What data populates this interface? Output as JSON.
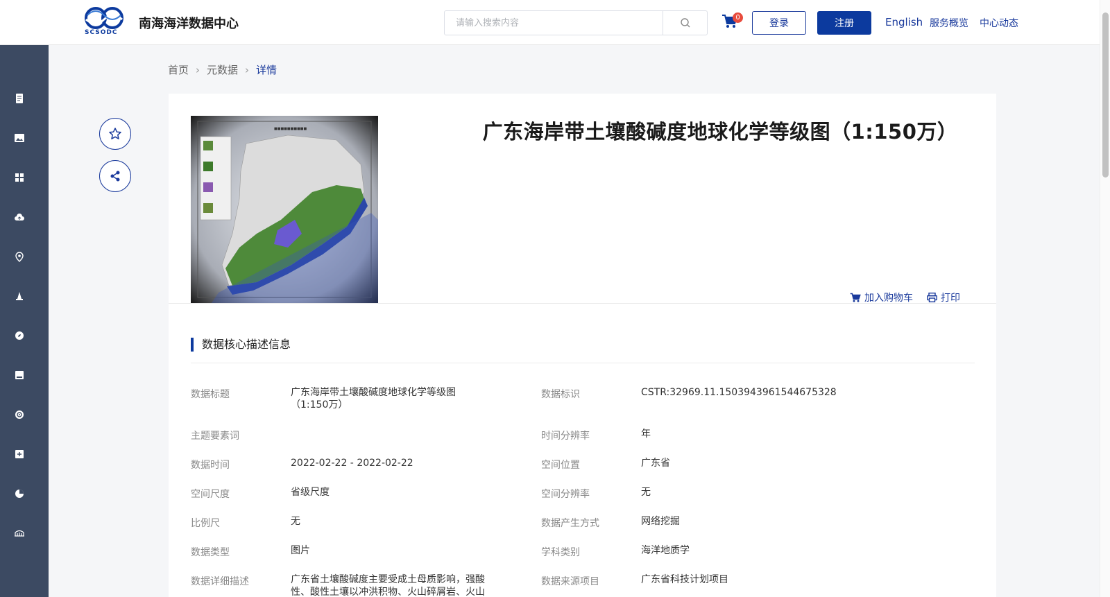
{
  "header": {
    "logo_text": "SCSODC",
    "site_name": "南海海洋数据中心",
    "search_placeholder": "请输入搜索内容",
    "cart_count": "0",
    "login_label": "登录",
    "register_label": "注册",
    "nav": [
      "English",
      "服务概览",
      "中心动态"
    ]
  },
  "sidebar": {
    "icons": [
      "document-icon",
      "image-icon",
      "grid-icon",
      "cloud-upload-icon",
      "location-icon",
      "tower-icon",
      "compass-icon",
      "card-icon",
      "target-icon",
      "plus-box-icon",
      "pie-chart-icon",
      "bridge-icon"
    ]
  },
  "breadcrumb": [
    "首页",
    "元数据",
    "详情"
  ],
  "detail": {
    "title": "广东海岸带土壤酸碱度地球化学等级图（1:150万）",
    "add_cart_label": "加入购物车",
    "print_label": "打印",
    "section_title": "数据核心描述信息"
  },
  "fields": [
    {
      "label": "数据标题",
      "value": "广东海岸带土壤酸碱度地球化学等级图（1:150万）"
    },
    {
      "label": "数据标识",
      "value": "CSTR:32969.11.1503943961544675328"
    },
    {
      "label": "主题要素词",
      "value": ""
    },
    {
      "label": "时间分辨率",
      "value": "年"
    },
    {
      "label": "数据时间",
      "value": "2022-02-22 - 2022-02-22"
    },
    {
      "label": "空间位置",
      "value": "广东省"
    },
    {
      "label": "空间尺度",
      "value": "省级尺度"
    },
    {
      "label": "空间分辨率",
      "value": "无"
    },
    {
      "label": "比例尺",
      "value": "无"
    },
    {
      "label": "数据产生方式",
      "value": "网络挖掘"
    },
    {
      "label": "数据类型",
      "value": "图片"
    },
    {
      "label": "学科类别",
      "value": "海洋地质学"
    },
    {
      "label": "数据详细描述",
      "value": "广东省土壤酸碱度主要受成土母质影响，强酸性、酸性土壤以冲洪积物、火山碎屑岩、火山"
    },
    {
      "label": "数据来源项目",
      "value": "广东省科技计划项目"
    }
  ],
  "colors": {
    "brand": "#0c3a9e",
    "sidebar": "#3c4a62",
    "badge": "#e84c3d"
  }
}
